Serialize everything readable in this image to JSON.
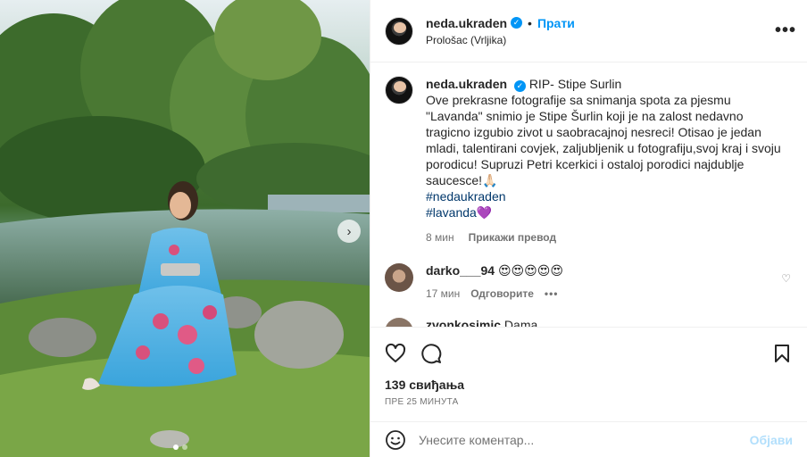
{
  "post": {
    "username": "neda.ukraden",
    "follow_label": "Прати",
    "location": "Prološac (Vrljika)",
    "caption": {
      "username": "neda.ukraden",
      "headline": "RIP- Stipe Surlin",
      "text": "Ove prekrasne fotografije sa snimanja spota za pjesmu \"Lavanda\" snimio je Stipe Šurlin koji je na zalost nedavno tragicno izgubio zivot u saobracajnoj nesreci! Otisao je jedan mladi, talentirani covjek, zaljubljenik u fotografiju,svoj kraj i svoju porodicu! Supruzi Petri kcerkici i ostaloj porodici najdublje saucesce!🙏🏻",
      "hashtag1": "#nedaukraden",
      "hashtag2": "#lavanda",
      "hashtag2_emoji": "💜",
      "age": "8 мин",
      "translate_label": "Прикажи превод"
    },
    "comments": [
      {
        "username": "darko___94",
        "text": "😍😍😍😍😍",
        "age": "17 мин",
        "reply_label": "Одговорите"
      },
      {
        "username": "zvonkosimic",
        "text": "Dama"
      }
    ],
    "likes": "139 свиђања",
    "posted_time": "ПРЕ 25 МИНУТА",
    "add_comment_placeholder": "Унесите коментар...",
    "post_button": "Објави"
  },
  "carousel": {
    "slides": 2,
    "active": 1
  },
  "colors": {
    "accent": "#0095f6",
    "link": "#00376b",
    "muted": "#737373",
    "border": "#efefef"
  }
}
